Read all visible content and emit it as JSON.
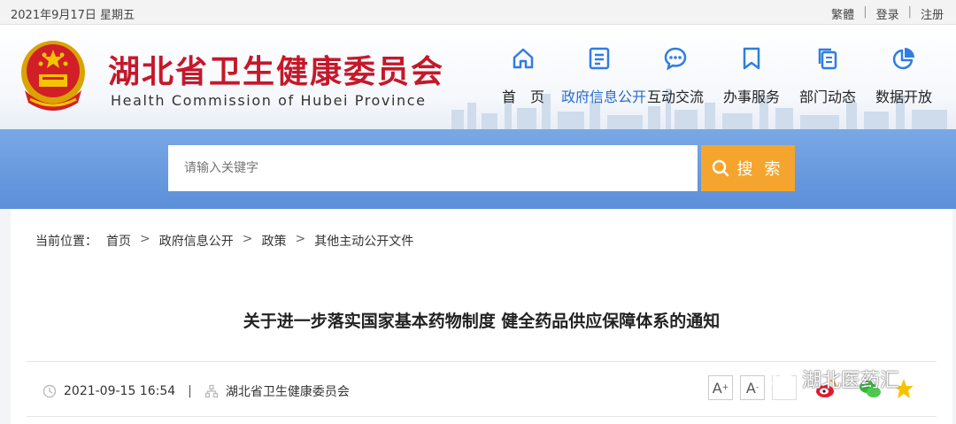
{
  "topbar": {
    "date": "2021年9月17日 星期五",
    "links": [
      "繁體",
      "登录",
      "注册"
    ]
  },
  "header": {
    "title_cn": "湖北省卫生健康委员会",
    "title_en": "Health Commission of Hubei Province",
    "nav": [
      {
        "label": "首　页",
        "icon": "home-icon"
      },
      {
        "label": "政府信息公开",
        "icon": "document-list-icon",
        "active": true
      },
      {
        "label": "互动交流",
        "icon": "chat-bubble-icon"
      },
      {
        "label": "办事服务",
        "icon": "bookmark-icon"
      },
      {
        "label": "部门动态",
        "icon": "copy-document-icon"
      },
      {
        "label": "数据开放",
        "icon": "pie-chart-icon"
      }
    ]
  },
  "search": {
    "placeholder": "请输入关键字",
    "button_label": "搜 索"
  },
  "breadcrumb": {
    "lead": "当前位置：",
    "items": [
      "首页",
      "政府信息公开",
      "政策",
      "其他主动公开文件"
    ]
  },
  "article": {
    "title": "关于进一步落实国家基本药物制度 健全药品供应保障体系的通知",
    "datetime": "2021-09-15 16:54",
    "source": "湖北省卫生健康委员会"
  },
  "watermark": "湖北医药汇",
  "colors": {
    "brand_red": "#c5182a",
    "nav_active": "#2a6bd0",
    "icon_blue": "#2f7de1",
    "band_blue": "#6b9ce0",
    "search_orange": "#f5a52d"
  }
}
